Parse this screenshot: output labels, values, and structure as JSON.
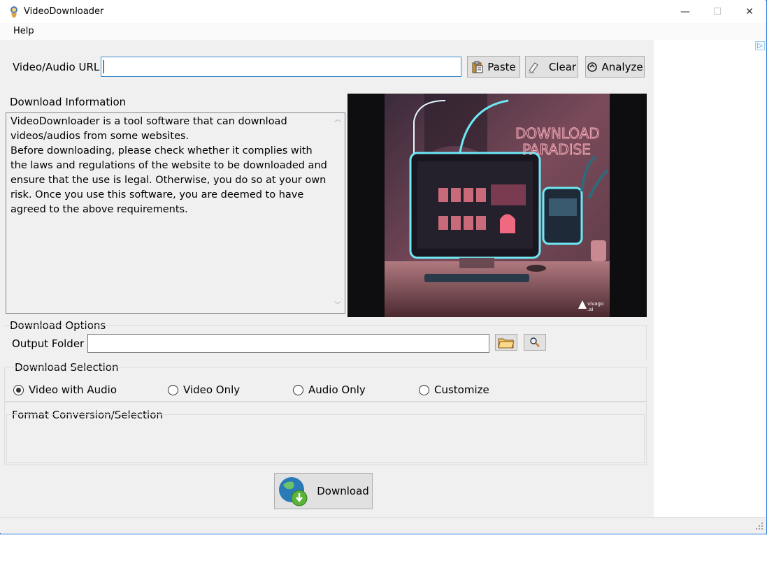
{
  "window": {
    "title": "VideoDownloader",
    "minimize": "—",
    "maximize": "☐",
    "close": "✕"
  },
  "menu": {
    "help": "Help"
  },
  "url_row": {
    "label": "Video/Audio URL",
    "value": "",
    "paste": "Paste",
    "clear": "Clear",
    "analyze": "Analyze"
  },
  "info": {
    "group_title": "Download Information",
    "text": "VideoDownloader is a tool software that can download videos/audios from some websites.\nBefore downloading, please check whether it complies with the laws and regulations of the website to be downloaded and ensure that the use is legal. Otherwise, you do so at your own risk. Once you use this software, you are deemed to have agreed to the above requirements."
  },
  "banner": {
    "headline_line1": "DOWNLOAD",
    "headline_line2": "PARADISE",
    "brand": "vivago",
    "brand_sub": ".ai"
  },
  "options": {
    "group_title": "Download Options",
    "output_label": "Output Folder",
    "output_value": ""
  },
  "selection": {
    "group_title": "Download Selection",
    "items": [
      {
        "label": "Video with Audio",
        "checked": true
      },
      {
        "label": "Video Only",
        "checked": false
      },
      {
        "label": "Audio Only",
        "checked": false
      },
      {
        "label": "Customize",
        "checked": false
      }
    ]
  },
  "format": {
    "group_title": "Format Conversion/Selection"
  },
  "download_button": {
    "label": "Download"
  },
  "icons": {
    "app": "app-icon",
    "paste": "clipboard-icon",
    "clear": "eraser-icon",
    "analyze": "refresh-icon",
    "folder": "folder-icon",
    "search": "magnifier-icon",
    "download": "globe-download-icon"
  },
  "colors": {
    "accent": "#3c8bd0",
    "window_border": "#2b79d8",
    "panel": "#f0f0f0"
  }
}
